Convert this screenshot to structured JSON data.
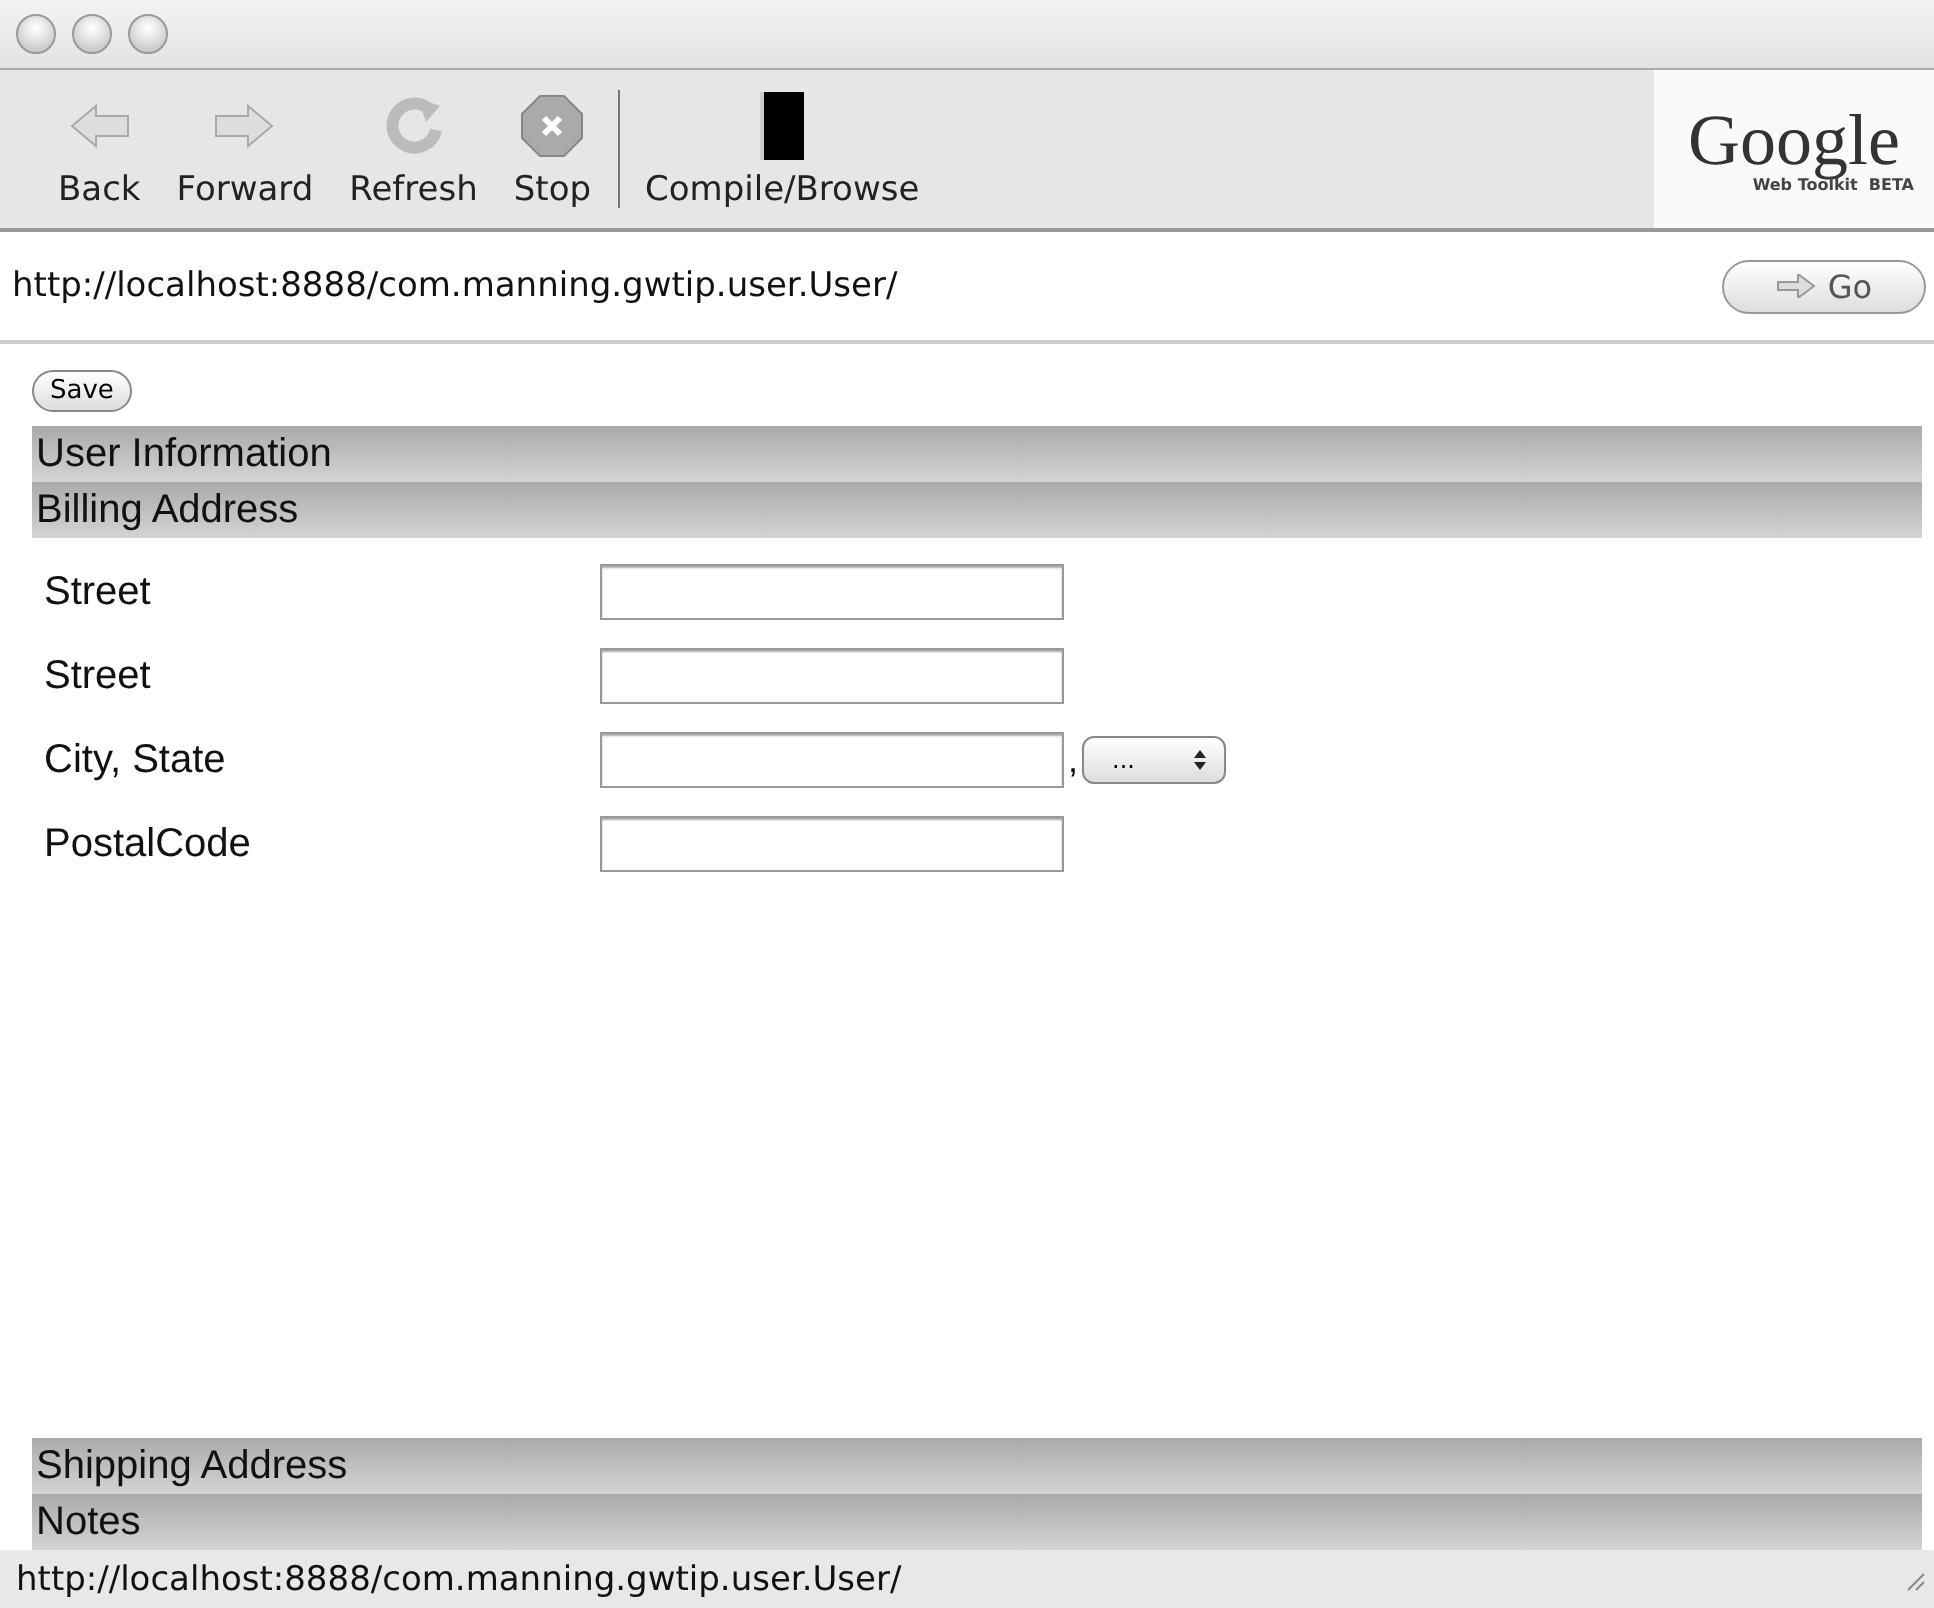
{
  "toolbar": {
    "buttons": [
      {
        "label": "Back",
        "kind": "back"
      },
      {
        "label": "Forward",
        "kind": "forward"
      },
      {
        "label": "Refresh",
        "kind": "refresh"
      },
      {
        "label": "Stop",
        "kind": "stop"
      },
      {
        "label": "Compile/Browse",
        "kind": "compile"
      }
    ],
    "logo": {
      "name": "Google",
      "sub": "Web Toolkit",
      "badge": "BETA"
    }
  },
  "address_bar": {
    "url": "http://localhost:8888/com.manning.gwtip.user.User/",
    "go": "Go"
  },
  "save_button": "Save",
  "sections": [
    {
      "title": "User Information"
    },
    {
      "title": "Billing Address",
      "fields": [
        {
          "label": "Street",
          "kind": "text"
        },
        {
          "label": "Street",
          "kind": "text"
        },
        {
          "label": "City, State",
          "kind": "text_select",
          "separator": ",",
          "select": "..."
        },
        {
          "label": "PostalCode",
          "kind": "text"
        }
      ]
    },
    {
      "title": "Shipping Address"
    },
    {
      "title": "Notes"
    }
  ],
  "status_bar": "http://localhost:8888/com.manning.gwtip.user.User/"
}
